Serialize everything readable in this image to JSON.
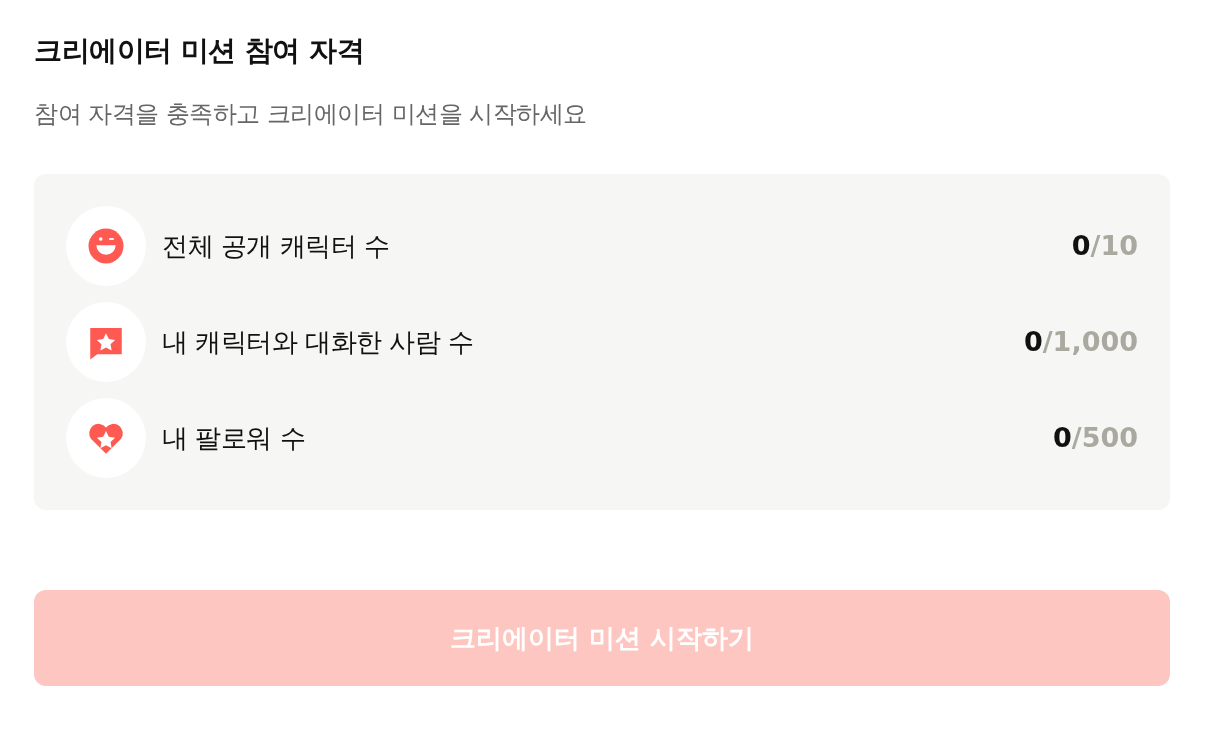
{
  "title": "크리에이터 미션 참여 자격",
  "subtitle": "참여 자격을 충족하고 크리에이터 미션을 시작하세요",
  "requirements": [
    {
      "kind": "smile",
      "label": "전체 공개 캐릭터 수",
      "current": "0",
      "target": "/10"
    },
    {
      "kind": "chat",
      "label": "내 캐릭터와 대화한 사람 수",
      "current": "0",
      "target": "/1,000"
    },
    {
      "kind": "heart",
      "label": "내 팔로워 수",
      "current": "0",
      "target": "/500"
    }
  ],
  "button": {
    "label": "크리에이터 미션 시작하기",
    "disabled": true
  }
}
